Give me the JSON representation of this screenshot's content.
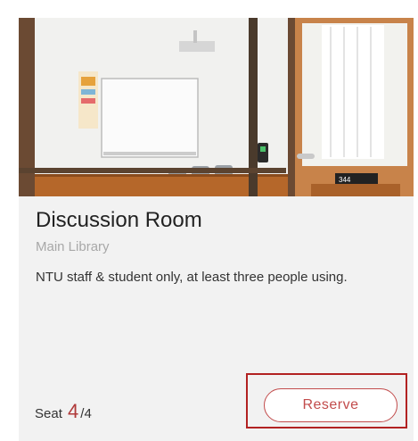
{
  "room": {
    "title": "Discussion Room",
    "location": "Main Library",
    "description": "NTU staff & student only, at least three people using.",
    "photo_icon": "room-photo",
    "door_sign": "344"
  },
  "seat": {
    "label": "Seat",
    "available": "4",
    "separator": "/",
    "total": "4"
  },
  "actions": {
    "reserve_label": "Reserve"
  },
  "colors": {
    "accent": "#c24c4c",
    "highlight": "#b22222",
    "card_bg": "#f2f2f2"
  }
}
